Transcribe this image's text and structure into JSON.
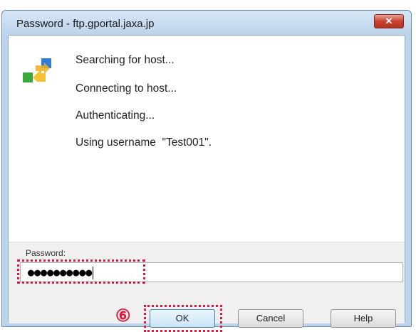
{
  "window": {
    "title": "Password - ftp.gportal.jaxa.jp",
    "close_label": "✕"
  },
  "log": {
    "lines": [
      "Searching for host...",
      "Connecting to host...",
      "Authenticating...",
      "Using username  \"Test001\"."
    ]
  },
  "password": {
    "label": "Password:",
    "value": "●●●●●●●●●●"
  },
  "annotation": {
    "step_marker": "⑥"
  },
  "buttons": {
    "ok": "OK",
    "cancel": "Cancel",
    "help": "Help"
  },
  "colors": {
    "highlight": "#e0193a",
    "titlebar": "#bcd3ea"
  }
}
